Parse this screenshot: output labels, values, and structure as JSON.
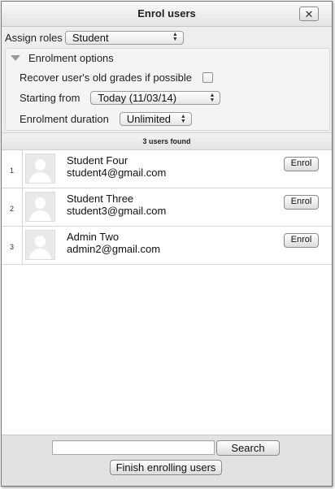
{
  "dialog": {
    "title": "Enrol users",
    "close_icon": "close-icon",
    "close_glyph": "✕"
  },
  "assign": {
    "label": "Assign roles",
    "selected": "Student"
  },
  "enrolment_options": {
    "legend": "Enrolment options",
    "recover_label": "Recover user's old grades if possible",
    "recover_checked": false,
    "starting_label": "Starting from",
    "starting_value": "Today (11/03/14)",
    "duration_label": "Enrolment duration",
    "duration_value": "Unlimited"
  },
  "results": {
    "count_text": "3 users found",
    "users": [
      {
        "index": "1",
        "name": "Student Four",
        "email": "student4@gmail.com",
        "action": "Enrol"
      },
      {
        "index": "2",
        "name": "Student Three",
        "email": "student3@gmail.com",
        "action": "Enrol"
      },
      {
        "index": "3",
        "name": "Admin Two",
        "email": "admin2@gmail.com",
        "action": "Enrol"
      }
    ]
  },
  "footer": {
    "search_value": "",
    "search_button": "Search",
    "finish_button": "Finish enrolling users"
  }
}
